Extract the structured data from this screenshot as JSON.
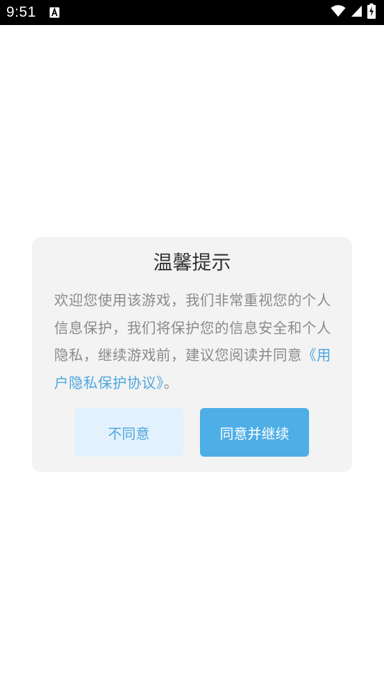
{
  "status_bar": {
    "time": "9:51",
    "notification_icon": "font-a-icon",
    "icons": [
      "wifi-icon",
      "signal-icon",
      "battery-charging-icon"
    ]
  },
  "dialog": {
    "title": "温馨提示",
    "message_text": "欢迎您使用该游戏，我们非常重视您的个人信息保护，我们将保护您的信息安全和个人隐私，继续游戏前，建议您阅读并同意",
    "message_link": "《用户隐私保护协议》",
    "message_end": "。",
    "disagree_label": "不同意",
    "agree_label": "同意并继续"
  },
  "colors": {
    "link": "#4ea7df",
    "primary_button": "#4eaee6",
    "secondary_button": "#e2f1fb",
    "dialog_bg": "#f3f3f3"
  }
}
